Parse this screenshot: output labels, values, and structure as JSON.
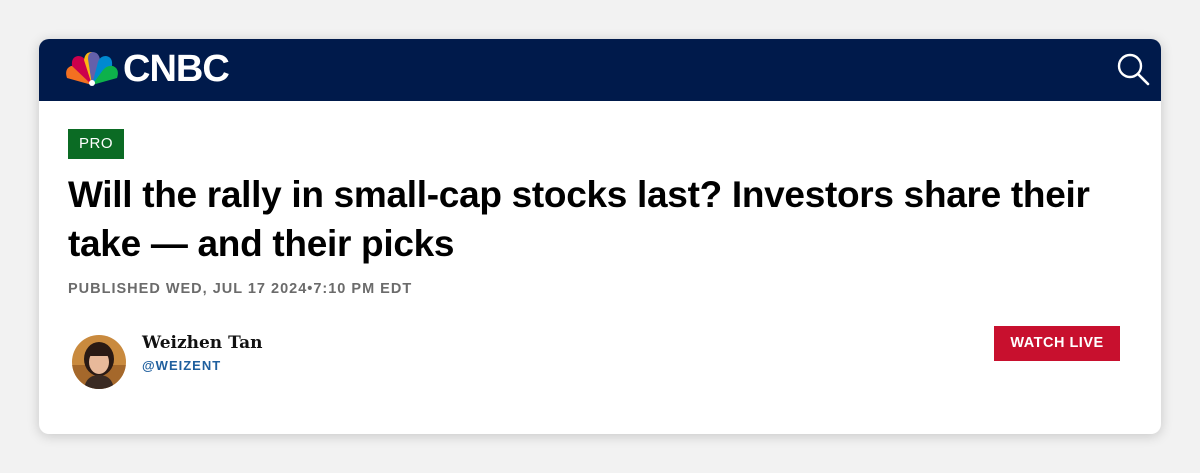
{
  "header": {
    "logo_text": "CNBC",
    "logo_icon": "peacock-logo-icon",
    "search_icon": "search-icon",
    "bar_color": "#001a4b"
  },
  "article": {
    "badge": "PRO",
    "badge_color": "#0b6b24",
    "headline": "Will the rally in small-cap stocks last? Investors share their take — and their picks",
    "published": "PUBLISHED WED, JUL 17 2024•7:10 PM EDT"
  },
  "author": {
    "name": "Weizhen Tan",
    "handle": "@WEIZENT",
    "avatar_icon": "author-avatar"
  },
  "watch_live": {
    "label": "WATCH LIVE",
    "color": "#c8102e"
  }
}
